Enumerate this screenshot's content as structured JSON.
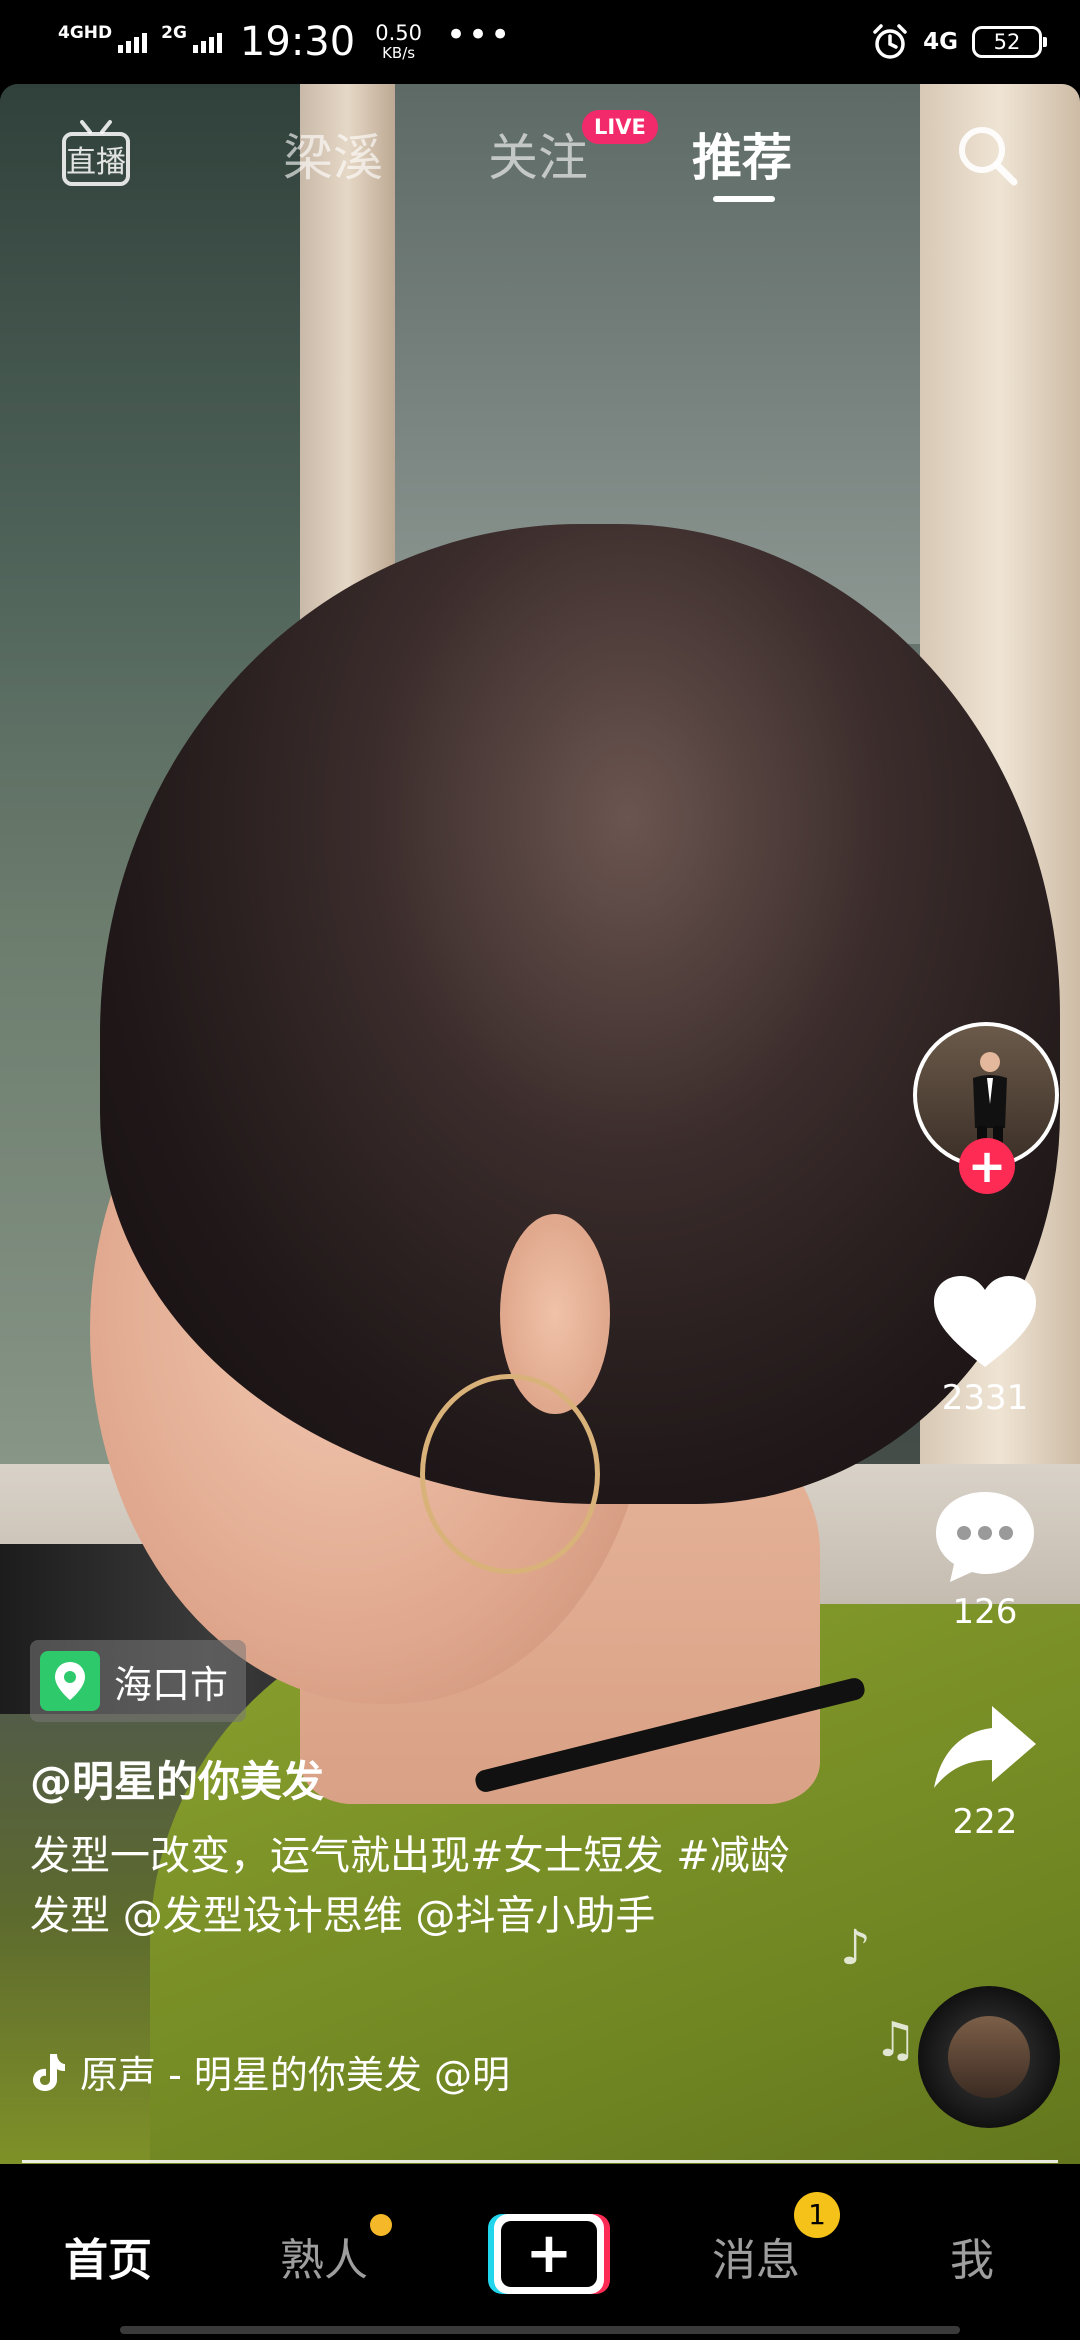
{
  "status_bar": {
    "sim1_label": "4GHD",
    "sim2_label": "2G",
    "time": "19:30",
    "speed_value": "0.50",
    "speed_unit": "KB/s",
    "more": "•••",
    "network": "4G",
    "battery": "52",
    "icons": [
      "signal-icon",
      "alarm-icon",
      "battery-icon"
    ]
  },
  "top_nav": {
    "live_icon_label": "直播",
    "tabs": [
      {
        "label": "梁溪",
        "active": false
      },
      {
        "label": "关注",
        "active": false
      },
      {
        "label": "推荐",
        "active": true
      }
    ],
    "live_badge": "LIVE"
  },
  "actions": {
    "likes": "2331",
    "comments": "126",
    "shares": "222",
    "follow_symbol": "+"
  },
  "post": {
    "location": "海口市",
    "author": "@明星的你美发",
    "caption": "发型一改变，运气就出现#女士短发 #减龄发型 @发型设计思维 @抖音小助手",
    "music": "原声 - 明星的你美发    @明"
  },
  "bottom_nav": {
    "items": [
      "首页",
      "熟人",
      "消息",
      "我"
    ],
    "active": "首页",
    "messages_badge": "1",
    "create_symbol": "+"
  },
  "colors": {
    "accent": "#fe2c55",
    "live_pink": "#f22a6b",
    "badge_yellow": "#f5c21a",
    "location_green": "#2ec96b",
    "cyan": "#20d5ec"
  }
}
